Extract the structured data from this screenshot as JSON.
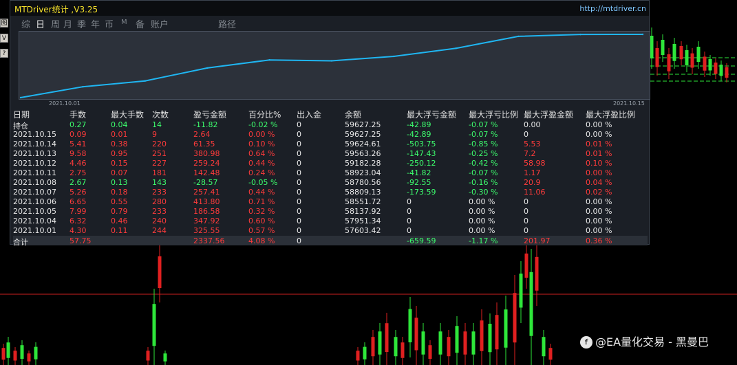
{
  "window": {
    "title": "MTDriver统计 ,V3.25",
    "url": "http://mtdriver.cn"
  },
  "side_buttons": [
    "图",
    "V",
    "?"
  ],
  "tabs": [
    {
      "label": "综",
      "active": false
    },
    {
      "label": "日",
      "active": true
    },
    {
      "label": "周",
      "active": false
    },
    {
      "label": "月",
      "active": false
    },
    {
      "label": "季",
      "active": false
    },
    {
      "label": "年",
      "active": false
    },
    {
      "label": "币",
      "active": false
    },
    {
      "label": "M",
      "active": false
    },
    {
      "label": "备",
      "active": false
    },
    {
      "label": "账户",
      "active": false
    },
    {
      "label": "路径",
      "active": false
    }
  ],
  "chart_data": {
    "type": "line",
    "x_start_label": "2021.10.01",
    "x_end_label": "2021.10.15",
    "x": [
      "2021.10.01",
      "2021.10.04",
      "2021.10.05",
      "2021.10.06",
      "2021.10.07",
      "2021.10.08",
      "2021.10.11",
      "2021.10.12",
      "2021.10.13",
      "2021.10.14",
      "2021.10.15"
    ],
    "series": [
      {
        "values": [
          57603.42,
          57951.34,
          58137.92,
          58551.72,
          58809.13,
          58780.56,
          58923.04,
          59182.28,
          59563.26,
          59624.61,
          59627.25
        ],
        "color": "#1fb6f2"
      }
    ],
    "ylim": [
      57603.42,
      59627.25
    ],
    "grid": false,
    "background": "#2c313a"
  },
  "table": {
    "headers": [
      "日期",
      "手数",
      "最大手数",
      "次数",
      "盈亏金额",
      "百分比%",
      "出入金",
      "余额",
      "最大浮亏金额",
      "最大浮亏比例",
      "最大浮盈金额",
      "最大浮盈比例"
    ],
    "rows": [
      {
        "cells": [
          "持仓",
          "0.27",
          "0.04",
          "14",
          "-11.82",
          "-0.02 %",
          "0",
          "59627.25",
          "-42.89",
          "-0.07 %",
          "0.00",
          "0.00 %"
        ],
        "colors": [
          "w",
          "g",
          "g",
          "g",
          "g",
          "g",
          "w",
          "w",
          "g",
          "g",
          "w",
          "w"
        ]
      },
      {
        "cells": [
          "2021.10.15",
          "0.09",
          "0.01",
          "9",
          "2.64",
          "0.00 %",
          "0",
          "59627.25",
          "-42.89",
          "-0.07 %",
          "0",
          "0.00 %"
        ],
        "colors": [
          "w",
          "r",
          "r",
          "r",
          "r",
          "r",
          "w",
          "w",
          "g",
          "g",
          "w",
          "w"
        ]
      },
      {
        "cells": [
          "2021.10.14",
          "5.41",
          "0.38",
          "220",
          "61.35",
          "0.10 %",
          "0",
          "59624.61",
          "-503.75",
          "-0.85 %",
          "5.53",
          "0.01 %"
        ],
        "colors": [
          "w",
          "r",
          "r",
          "r",
          "r",
          "r",
          "w",
          "w",
          "g",
          "g",
          "r",
          "r"
        ]
      },
      {
        "cells": [
          "2021.10.13",
          "9.58",
          "0.95",
          "251",
          "380.98",
          "0.64 %",
          "0",
          "59563.26",
          "-147.43",
          "-0.25 %",
          "7.2",
          "0.01 %"
        ],
        "colors": [
          "w",
          "r",
          "r",
          "r",
          "r",
          "r",
          "w",
          "w",
          "g",
          "g",
          "r",
          "r"
        ]
      },
      {
        "cells": [
          "2021.10.12",
          "4.46",
          "0.15",
          "227",
          "259.24",
          "0.44 %",
          "0",
          "59182.28",
          "-250.12",
          "-0.42 %",
          "58.98",
          "0.10 %"
        ],
        "colors": [
          "w",
          "r",
          "r",
          "r",
          "r",
          "r",
          "w",
          "w",
          "g",
          "g",
          "r",
          "r"
        ]
      },
      {
        "cells": [
          "2021.10.11",
          "2.75",
          "0.07",
          "181",
          "142.48",
          "0.24 %",
          "0",
          "58923.04",
          "-41.82",
          "-0.07 %",
          "1.17",
          "0.00 %"
        ],
        "colors": [
          "w",
          "r",
          "r",
          "r",
          "r",
          "r",
          "w",
          "w",
          "g",
          "g",
          "r",
          "r"
        ]
      },
      {
        "cells": [
          "2021.10.08",
          "2.67",
          "0.13",
          "143",
          "-28.57",
          "-0.05 %",
          "0",
          "58780.56",
          "-92.55",
          "-0.16 %",
          "20.9",
          "0.04 %"
        ],
        "colors": [
          "w",
          "g",
          "g",
          "g",
          "g",
          "g",
          "w",
          "w",
          "g",
          "g",
          "r",
          "r"
        ]
      },
      {
        "cells": [
          "2021.10.07",
          "5.26",
          "0.18",
          "233",
          "257.41",
          "0.44 %",
          "0",
          "58809.13",
          "-173.59",
          "-0.30 %",
          "11.06",
          "0.02 %"
        ],
        "colors": [
          "w",
          "r",
          "r",
          "r",
          "r",
          "r",
          "w",
          "w",
          "g",
          "g",
          "r",
          "r"
        ]
      },
      {
        "cells": [
          "2021.10.06",
          "6.65",
          "0.55",
          "280",
          "413.80",
          "0.71 %",
          "0",
          "58551.72",
          "0",
          "0.00 %",
          "0",
          "0.00 %"
        ],
        "colors": [
          "w",
          "r",
          "r",
          "r",
          "r",
          "r",
          "w",
          "w",
          "w",
          "w",
          "w",
          "w"
        ]
      },
      {
        "cells": [
          "2021.10.05",
          "7.99",
          "0.79",
          "233",
          "186.58",
          "0.32 %",
          "0",
          "58137.92",
          "0",
          "0.00 %",
          "0",
          "0.00 %"
        ],
        "colors": [
          "w",
          "r",
          "r",
          "r",
          "r",
          "r",
          "w",
          "w",
          "w",
          "w",
          "w",
          "w"
        ]
      },
      {
        "cells": [
          "2021.10.04",
          "6.32",
          "0.46",
          "240",
          "347.92",
          "0.60 %",
          "0",
          "57951.34",
          "0",
          "0.00 %",
          "0",
          "0.00 %"
        ],
        "colors": [
          "w",
          "r",
          "r",
          "r",
          "r",
          "r",
          "w",
          "w",
          "w",
          "w",
          "w",
          "w"
        ]
      },
      {
        "cells": [
          "2021.10.01",
          "4.30",
          "0.11",
          "244",
          "325.55",
          "0.57 %",
          "0",
          "57603.42",
          "0",
          "0.00 %",
          "0",
          "0.00 %"
        ],
        "colors": [
          "w",
          "r",
          "r",
          "r",
          "r",
          "r",
          "w",
          "w",
          "w",
          "w",
          "w",
          "w"
        ]
      }
    ],
    "total": {
      "cells": [
        "合计",
        "57.75",
        "",
        "",
        "2337.56",
        "4.08 %",
        "0",
        "",
        "-659.59",
        "-1.17 %",
        "201.97",
        "0.36 %"
      ],
      "colors": [
        "w",
        "r",
        "r",
        "r",
        "r",
        "r",
        "w",
        "w",
        "g",
        "g",
        "r",
        "r"
      ]
    }
  },
  "watermark": {
    "logo": "ꬵ",
    "text": "@EA量化交易 - 黑曼巴"
  },
  "colors": {
    "profit": "#ff3b3b",
    "loss": "#3dff6e",
    "neutral": "#e8e8e8",
    "equity_line": "#1fb6f2",
    "price_line": "#cc2020",
    "bull_candle": "#2ee63a",
    "bear_candle": "#e02020"
  }
}
